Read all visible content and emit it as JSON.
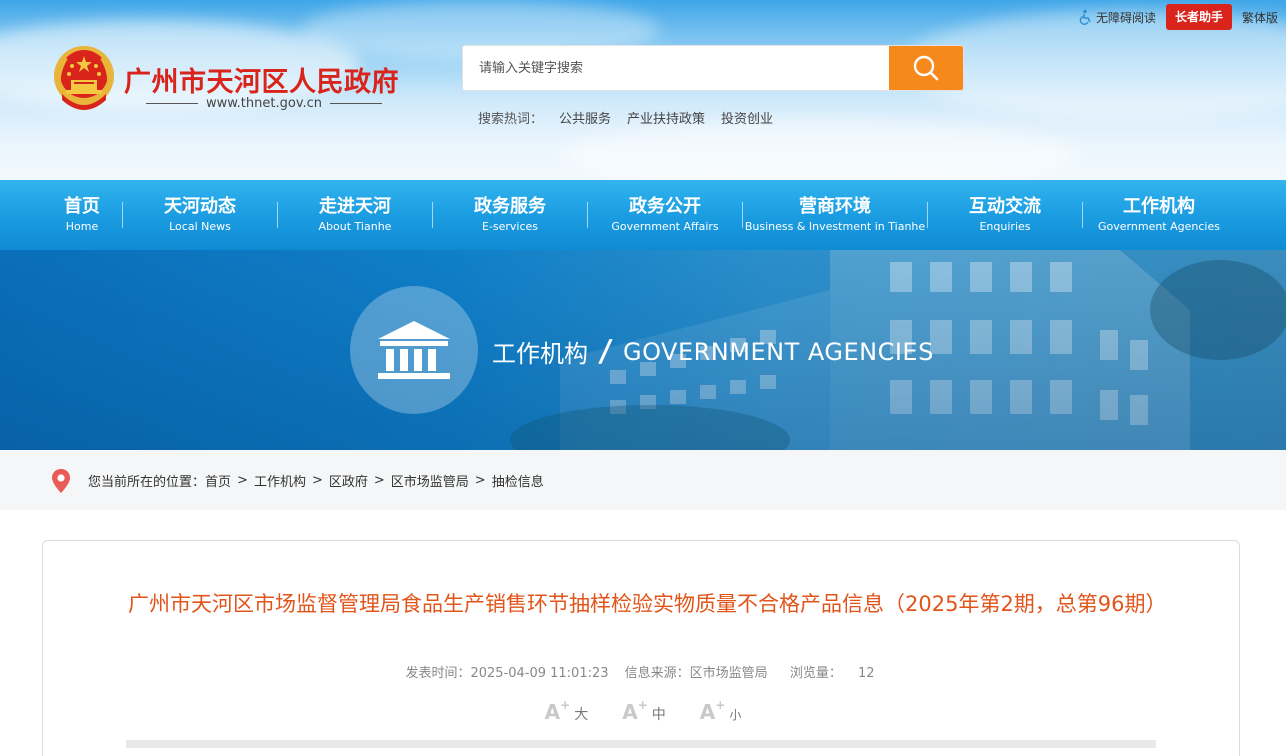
{
  "header": {
    "site_title": "广州市天河区人民政府",
    "site_url": "www.thnet.gov.cn",
    "search": {
      "placeholder": "请输入关键字搜索"
    },
    "hot_label": "搜索热词：",
    "hot_words": [
      "公共服务",
      "产业扶持政策",
      "投资创业"
    ],
    "top_links": {
      "accessibility": "无障碍阅读",
      "elder_mode": "长者助手",
      "traditional": "繁体版"
    }
  },
  "nav": {
    "items": [
      {
        "cn": "首页",
        "en": "Home"
      },
      {
        "cn": "天河动态",
        "en": "Local News"
      },
      {
        "cn": "走进天河",
        "en": "About Tianhe"
      },
      {
        "cn": "政务服务",
        "en": "E-services"
      },
      {
        "cn": "政务公开",
        "en": "Government Affairs"
      },
      {
        "cn": "营商环境",
        "en": "Business & Investment in Tianhe"
      },
      {
        "cn": "互动交流",
        "en": "Enquiries"
      },
      {
        "cn": "工作机构",
        "en": "Government Agencies"
      }
    ]
  },
  "banner": {
    "title_cn": "工作机构",
    "slash": "/",
    "title_en": "GOVERNMENT AGENCIES"
  },
  "breadcrumb": {
    "label": "您当前所在的位置：",
    "items": [
      "首页",
      "工作机构",
      "区政府",
      "区市场监管局",
      "抽检信息"
    ],
    "separator": ">"
  },
  "article": {
    "title": "广州市天河区市场监督管理局食品生产销售环节抽样检验实物质量不合格产品信息（2025年第2期，总第96期）",
    "publish_time": "发表时间：2025-04-09 11:01:23",
    "source": "信息来源：区市场监管局",
    "views_label": "浏览量：",
    "views": "12",
    "font_sizes": {
      "glyph": "A",
      "plus": "+",
      "large": "大",
      "medium": "中",
      "small": "小"
    }
  },
  "colors": {
    "brand_red": "#d9241c",
    "nav_blue": "#1d9fe3",
    "search_orange": "#f7891c",
    "title_orange": "#e1541a"
  },
  "icons": {
    "emblem": "national-emblem-icon",
    "search": "search-icon",
    "accessibility": "accessibility-icon",
    "banner": "building-columns-icon",
    "location": "location-pin-icon"
  }
}
